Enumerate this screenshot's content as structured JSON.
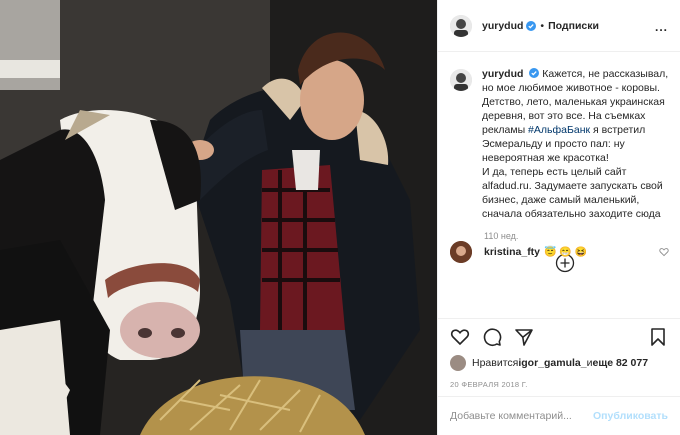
{
  "post": {
    "username": "yurydud",
    "follow_status": "Подписки",
    "dot": "•",
    "more": "...",
    "caption_user": "yurydud",
    "caption_lines": [
      "Кажется, не рассказывал,",
      "но мое любимое животное - коровы.",
      "Детство, лето, маленькая украинская",
      "деревня, вот это все. На съемках",
      "рекламы ",
      "#АльфаБанк",
      " я встретил",
      "Эсмеральду и просто пал: ну",
      "невероятная же красотка!",
      "И да, теперь есть целый сайт",
      "alfadud.ru. Задумаете запускать свой",
      "бизнес, даже самый маленький,",
      "сначала обязательно заходите сюда"
    ],
    "time_ago": "110 нед.",
    "comment": {
      "user": "kristina_fty",
      "emojis": "😇 😁 😆"
    },
    "likes_prefix": "Нравится ",
    "likes_user": "igor_gamula_",
    "likes_mid": " и ",
    "likes_count": "еще 82 077",
    "date": "20 ФЕВРАЛЯ 2018 Г.",
    "add_comment_placeholder": "Добавьте комментарий...",
    "publish_label": "Опубликовать"
  },
  "icons": {
    "verified": "verified-badge-icon",
    "like": "heart-icon",
    "comment": "comment-icon",
    "share": "share-icon",
    "save": "bookmark-icon",
    "load_more": "plus-circle-icon"
  },
  "colors": {
    "verified_blue": "#3897f0",
    "hashtag": "#00376b",
    "publish_disabled": "#b2dffc",
    "muted": "#8e8e8e"
  }
}
